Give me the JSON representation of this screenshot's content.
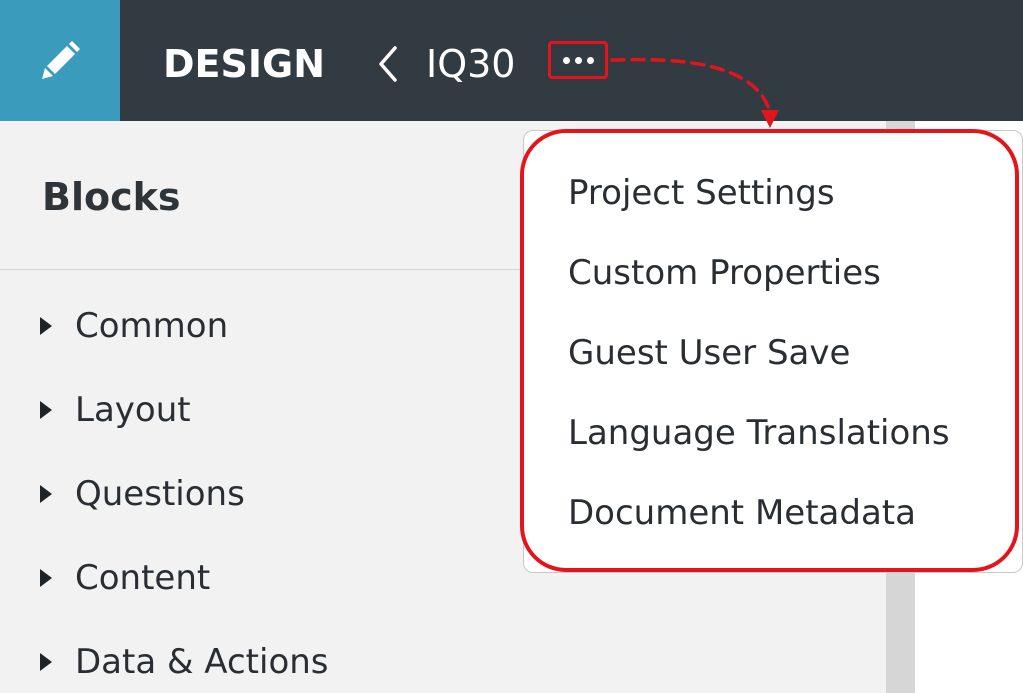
{
  "header": {
    "edit_icon": "pencil-icon",
    "app_title": "DESIGN",
    "back_icon": "chevron-left-icon",
    "project_name": "IQ30",
    "more_icon": "more-horizontal-icon"
  },
  "sidebar": {
    "heading": "Blocks",
    "categories": [
      {
        "label": "Common",
        "icon": "caret-right-icon"
      },
      {
        "label": "Layout",
        "icon": "caret-right-icon"
      },
      {
        "label": "Questions",
        "icon": "caret-right-icon"
      },
      {
        "label": "Content",
        "icon": "caret-right-icon"
      },
      {
        "label": "Data & Actions",
        "icon": "caret-right-icon"
      }
    ]
  },
  "menu": {
    "items": [
      {
        "label": "Project Settings"
      },
      {
        "label": "Custom Properties"
      },
      {
        "label": "Guest User Save"
      },
      {
        "label": "Language Translations"
      },
      {
        "label": "Document Metadata"
      }
    ]
  },
  "colors": {
    "topbar": "#323a42",
    "accent": "#3a9bbd",
    "annotation": "#e3141b",
    "sidebar_bg": "#f2f2f2"
  }
}
